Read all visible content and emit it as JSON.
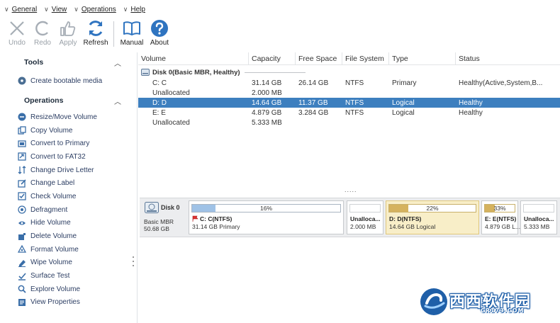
{
  "menu": [
    {
      "label": "General"
    },
    {
      "label": "View"
    },
    {
      "label": "Operations"
    },
    {
      "label": "Help"
    }
  ],
  "toolbar": {
    "undo": "Undo",
    "redo": "Redo",
    "apply": "Apply",
    "refresh": "Refresh",
    "manual": "Manual",
    "about": "About"
  },
  "sidebar": {
    "tools_title": "Tools",
    "create_bootable": "Create bootable media",
    "operations_title": "Operations",
    "operations": [
      {
        "label": "Resize/Move Volume",
        "icon": "resize-icon"
      },
      {
        "label": "Copy Volume",
        "icon": "copy-icon"
      },
      {
        "label": "Convert to Primary",
        "icon": "convert-icon"
      },
      {
        "label": "Convert to FAT32",
        "icon": "convert-fat-icon"
      },
      {
        "label": "Change Drive Letter",
        "icon": "drive-letter-icon"
      },
      {
        "label": "Change Label",
        "icon": "label-icon"
      },
      {
        "label": "Check Volume",
        "icon": "check-icon"
      },
      {
        "label": "Defragment",
        "icon": "defrag-icon"
      },
      {
        "label": "Hide Volume",
        "icon": "hide-icon"
      },
      {
        "label": "Delete Volume",
        "icon": "delete-icon"
      },
      {
        "label": "Format Volume",
        "icon": "format-icon"
      },
      {
        "label": "Wipe Volume",
        "icon": "wipe-icon"
      },
      {
        "label": "Surface Test",
        "icon": "surface-icon"
      },
      {
        "label": "Explore Volume",
        "icon": "explore-icon"
      },
      {
        "label": "View Properties",
        "icon": "properties-icon"
      }
    ]
  },
  "table": {
    "headers": [
      "Volume",
      "Capacity",
      "Free Space",
      "File System",
      "Type",
      "Status"
    ],
    "disk_label": "Disk 0(Basic MBR, Healthy)",
    "rows": [
      {
        "volume": "C: C",
        "capacity": "31.14 GB",
        "free": "26.14 GB",
        "fs": "NTFS",
        "type": "Primary",
        "status": "Healthy(Active,System,B..."
      },
      {
        "volume": "Unallocated",
        "capacity": "2.000 MB",
        "free": "",
        "fs": "",
        "type": "",
        "status": ""
      },
      {
        "volume": "D: D",
        "capacity": "14.64 GB",
        "free": "11.37 GB",
        "fs": "NTFS",
        "type": "Logical",
        "status": "Healthy"
      },
      {
        "volume": "E: E",
        "capacity": "4.879 GB",
        "free": "3.284 GB",
        "fs": "NTFS",
        "type": "Logical",
        "status": "Healthy"
      },
      {
        "volume": "Unallocated",
        "capacity": "5.333 MB",
        "free": "",
        "fs": "",
        "type": "",
        "status": ""
      }
    ],
    "selected_row": 2,
    "splitter_dots": "....."
  },
  "diskmap": {
    "name": "Disk 0",
    "type": "Basic MBR",
    "size": "50.68 GB",
    "partitions": [
      {
        "title": "C: C(NTFS)",
        "desc": "31.14 GB Primary",
        "pct_label": "16%",
        "used": 0.16
      },
      {
        "title": "Unalloca...",
        "desc": "2.000 MB"
      },
      {
        "title": "D: D(NTFS)",
        "desc": "14.64 GB Logical",
        "pct_label": "22%",
        "used": 0.22
      },
      {
        "title": "E: E(NTFS)",
        "desc": "4.879 GB L...",
        "pct_label": "33%",
        "used": 0.33
      },
      {
        "title": "Unalloca...",
        "desc": "5.333 MB"
      }
    ]
  },
  "watermark": {
    "text": "西西软件园",
    "sub": "CR173.COM"
  },
  "colors": {
    "selection": "#3d7fbf",
    "blue_icon": "#2f74c0",
    "bar_fill": "#9fc2e6",
    "gold_fill": "#d5b25e"
  }
}
